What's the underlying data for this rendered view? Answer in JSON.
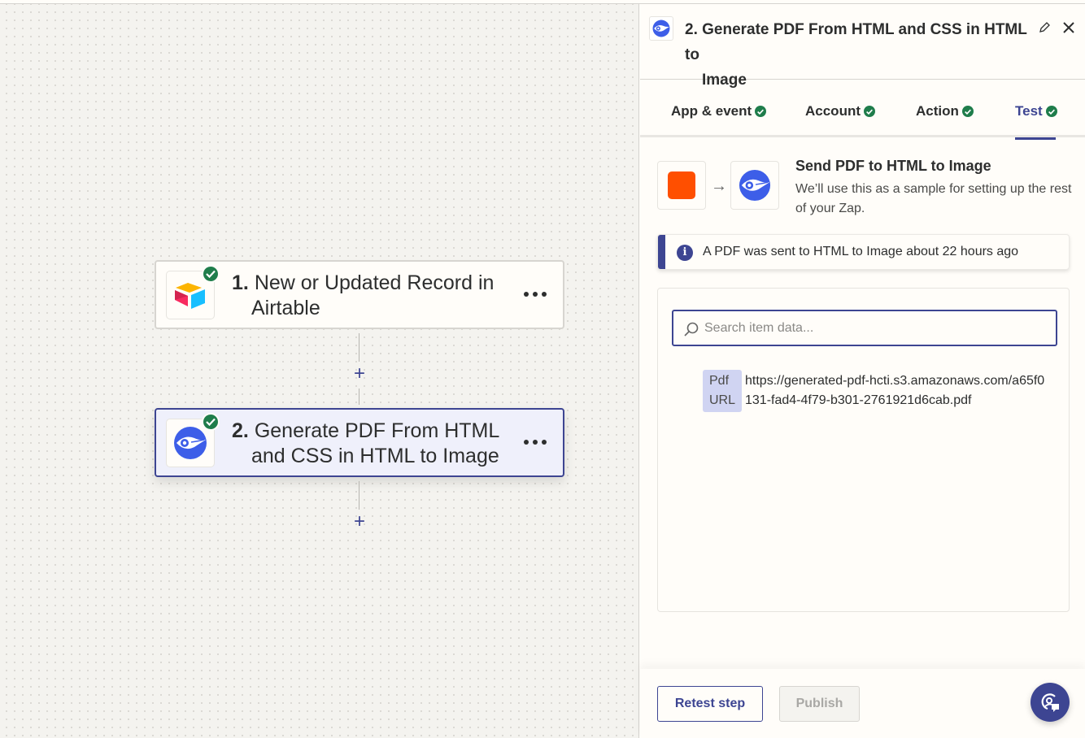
{
  "canvas": {
    "steps": [
      {
        "number": "1.",
        "title_line1": "New or Updated Record in",
        "title_line2": "Airtable",
        "app": "airtable-icon",
        "status": "complete",
        "selected": false
      },
      {
        "number": "2.",
        "title_line1": "Generate PDF From HTML",
        "title_line2": "and CSS in HTML to Image",
        "app": "html-to-image-icon",
        "status": "complete",
        "selected": true
      }
    ],
    "add_step_label": "+"
  },
  "panel": {
    "title_line1": "2. Generate PDF From HTML and CSS in HTML to",
    "title_line2": "Image",
    "tabs": [
      {
        "label": "App & event",
        "status": "complete"
      },
      {
        "label": "Account",
        "status": "complete"
      },
      {
        "label": "Action",
        "status": "complete"
      },
      {
        "label": "Test",
        "status": "complete",
        "active": true
      }
    ],
    "send": {
      "title": "Send PDF to HTML to Image",
      "description": "We’ll use this as a sample for setting up the rest of your Zap."
    },
    "info": {
      "text": "A PDF was sent to HTML to Image about 22 hours ago",
      "icon": "i"
    },
    "search": {
      "placeholder": "Search item data...",
      "value": ""
    },
    "items": [
      {
        "key": "Pdf URL",
        "value": "https://generated-pdf-hcti.s3.amazonaws.com/a65f0131-fad4-4f79-b301-2761921d6cab.pdf"
      }
    ],
    "footer": {
      "retest_label": "Retest step",
      "publish_label": "Publish"
    }
  },
  "colors": {
    "accent": "#3d4592",
    "success": "#1f7d4b",
    "trigger_orange": "#ff4f00",
    "app_blue": "#3d5ee8",
    "key_chip": "#d0d4f2"
  }
}
